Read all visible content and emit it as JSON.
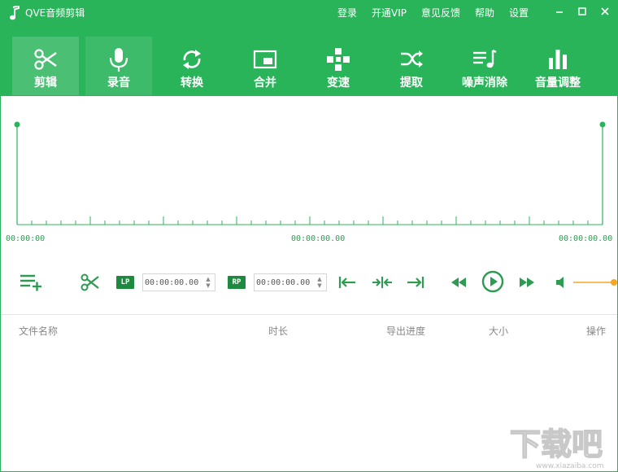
{
  "app": {
    "title": "QVE音频剪辑"
  },
  "top_menu": [
    "登录",
    "开通VIP",
    "意见反馈",
    "帮助",
    "设置"
  ],
  "toolbar": {
    "tools": [
      {
        "label": "剪辑",
        "icon": "scissors-icon"
      },
      {
        "label": "录音",
        "icon": "microphone-icon"
      },
      {
        "label": "转换",
        "icon": "refresh-icon"
      },
      {
        "label": "合并",
        "icon": "merge-icon"
      },
      {
        "label": "变速",
        "icon": "speed-icon"
      },
      {
        "label": "提取",
        "icon": "shuffle-icon"
      },
      {
        "label": "噪声消除",
        "icon": "noise-icon"
      },
      {
        "label": "音量调整",
        "icon": "volume-bars-icon"
      }
    ]
  },
  "timeline": {
    "start": "00:00:00",
    "middle": "00:00:00.00",
    "end": "00:00:00.00"
  },
  "controls": {
    "lp_label": "LP",
    "rp_label": "RP",
    "lp_time": "00:00:00.00",
    "rp_time": "00:00:00.00",
    "volume": 1.0
  },
  "file_table": {
    "columns": [
      "文件名称",
      "时长",
      "导出进度",
      "大小",
      "操作"
    ]
  },
  "watermark": {
    "text": "下载吧",
    "url": "www.xiazaiba.com"
  },
  "colors": {
    "accent": "#29b45a",
    "dark_accent": "#1e8a3f",
    "volume_slider": "#f5a623"
  }
}
